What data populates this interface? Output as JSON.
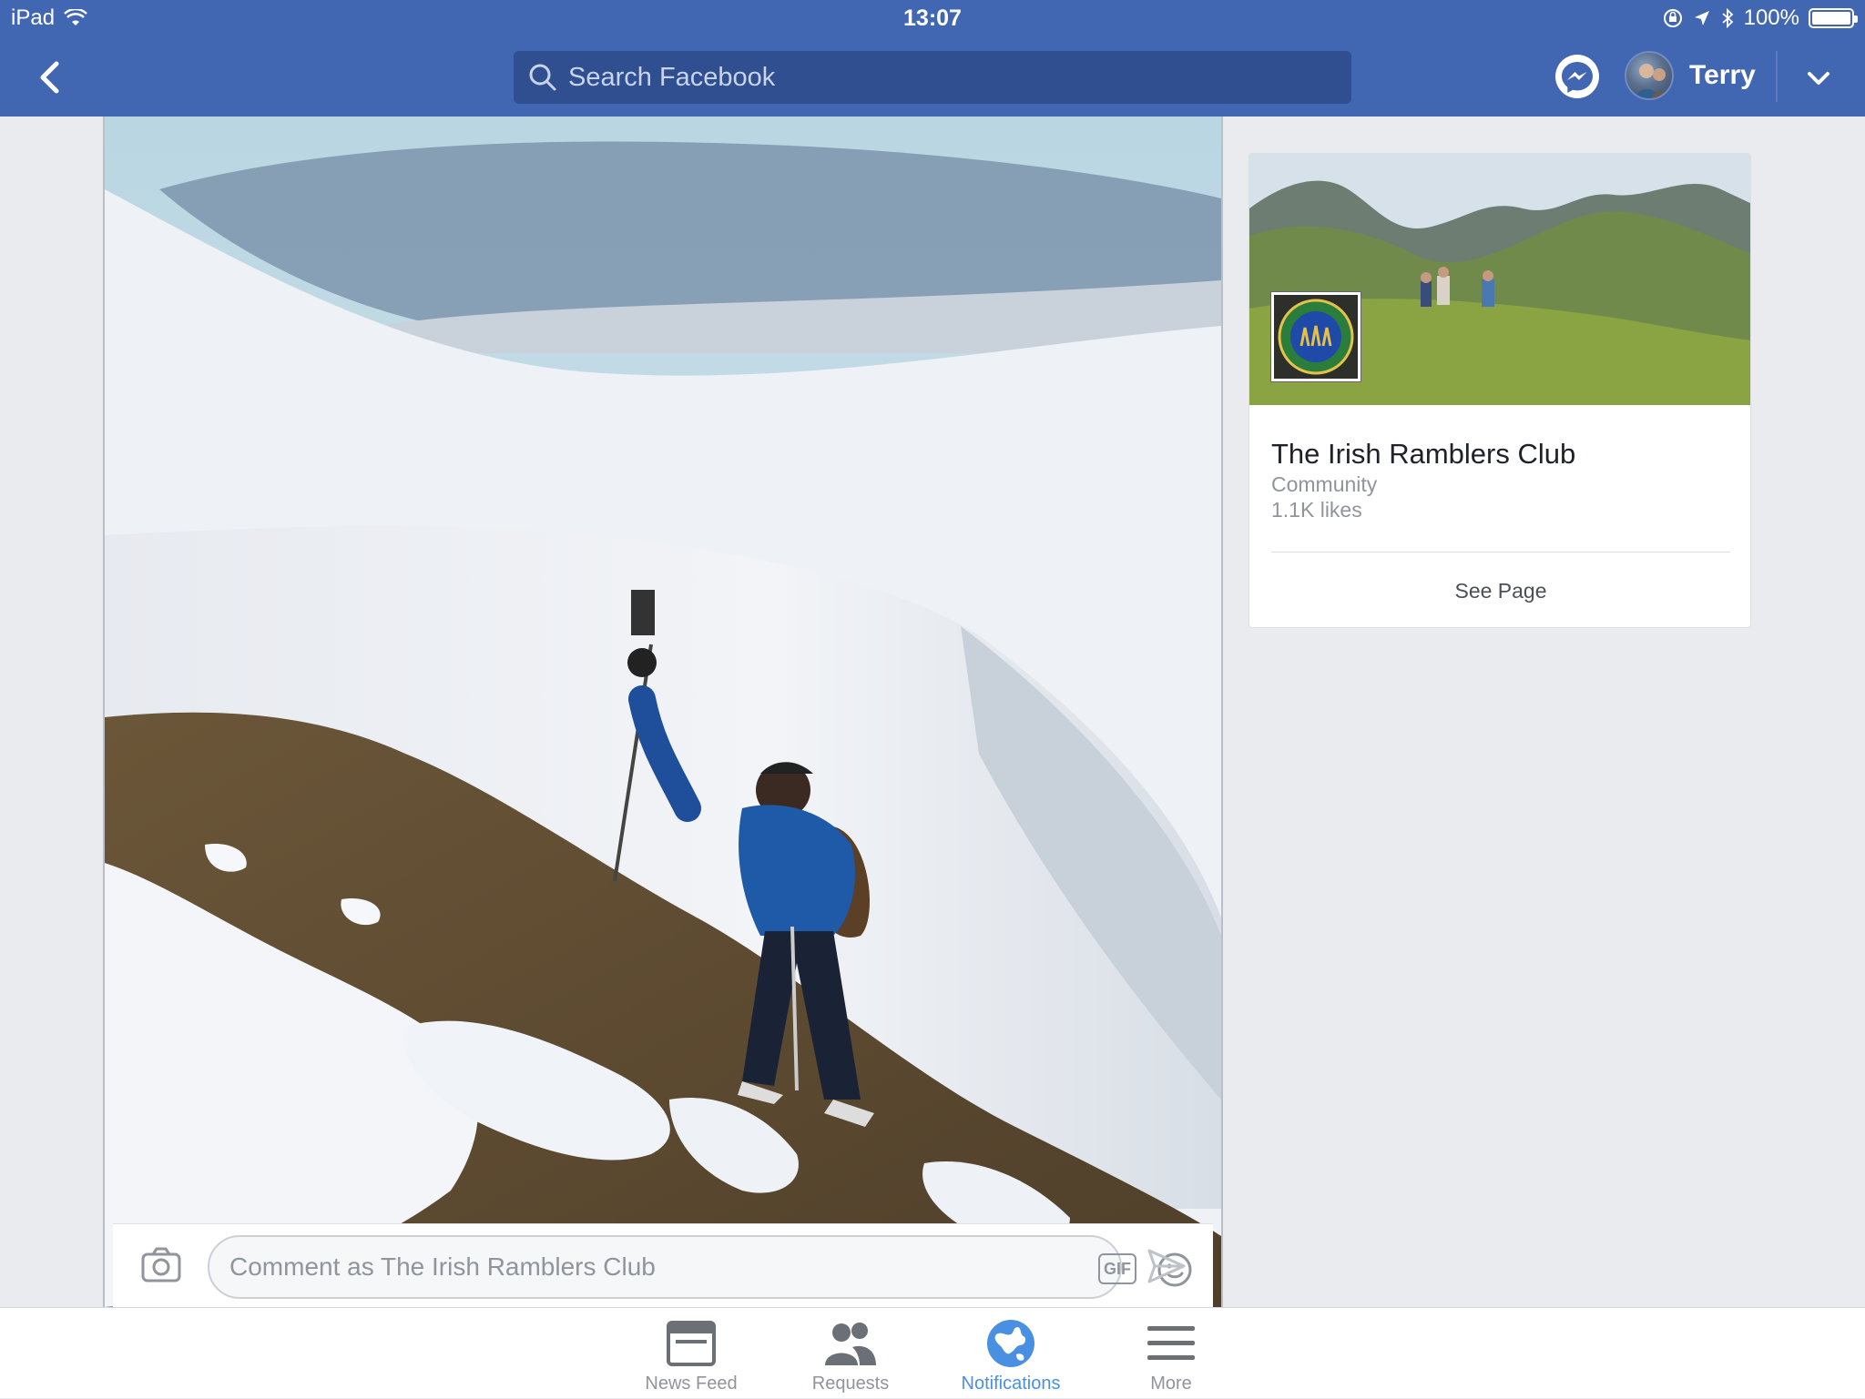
{
  "status_bar": {
    "device": "iPad",
    "time": "13:07",
    "battery": "100%",
    "battery_level": 1.0
  },
  "nav": {
    "search_placeholder": "Search Facebook",
    "profile_name": "Terry",
    "accent": "#4267b2"
  },
  "comment": {
    "placeholder": "Comment as The Irish Ramblers Club",
    "gif_label": "GIF"
  },
  "page_card": {
    "title": "The Irish Ramblers Club",
    "category": "Community",
    "likes": "1.1K likes",
    "see_page": "See Page"
  },
  "tabs": [
    {
      "label": "News Feed",
      "icon": "news-feed-icon",
      "active": false
    },
    {
      "label": "Requests",
      "icon": "friends-icon",
      "active": false
    },
    {
      "label": "Notifications",
      "icon": "globe-icon",
      "active": true
    },
    {
      "label": "More",
      "icon": "menu-icon",
      "active": false
    }
  ],
  "colors": {
    "active_tab": "#4a90e2",
    "inactive_tab": "#90949c"
  }
}
